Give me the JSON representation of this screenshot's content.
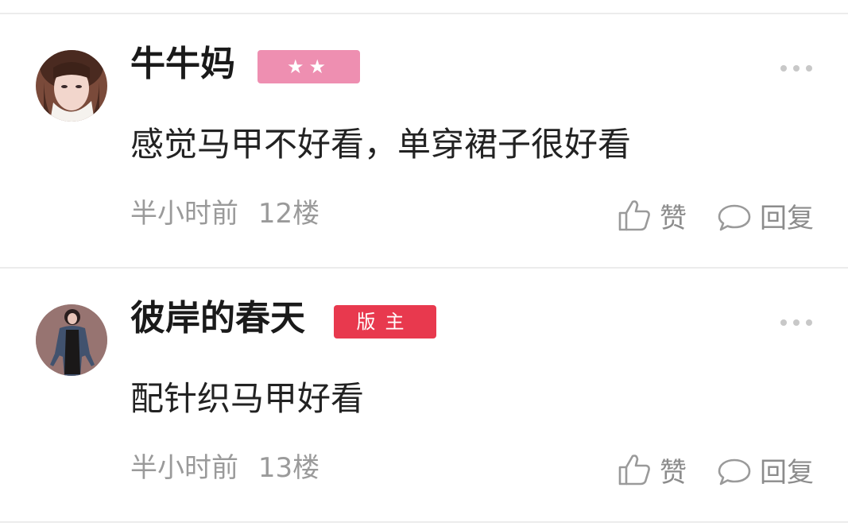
{
  "comments": [
    {
      "user": "牛牛妈",
      "badge": "★★",
      "badge_type": "level-stars",
      "badge_color": "#ee8fb1",
      "text": "感觉马甲不好看，单穿裙子很好看",
      "time": "半小时前",
      "floor": "12楼",
      "like_label": "赞",
      "reply_label": "回复"
    },
    {
      "user": "彼岸的春天",
      "badge": "版主",
      "badge_type": "moderator",
      "badge_color": "#e8394e",
      "text": "配针织马甲好看",
      "time": "半小时前",
      "floor": "13楼",
      "like_label": "赞",
      "reply_label": "回复"
    }
  ],
  "icons": {
    "like": "thumbs-up-icon",
    "reply": "speech-bubble-icon",
    "more": "more-dots-icon"
  }
}
